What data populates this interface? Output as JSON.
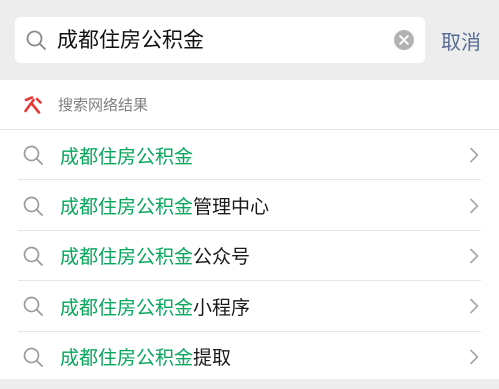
{
  "search": {
    "query": "成都住房公积金",
    "cancel_label": "取消"
  },
  "section": {
    "title": "搜索网络结果",
    "logo_icon": "souyisou-logo-icon",
    "logo_color": "#e53935"
  },
  "results": [
    {
      "highlight": "成都住房公积金",
      "suffix": ""
    },
    {
      "highlight": "成都住房公积金",
      "suffix": "管理中心"
    },
    {
      "highlight": "成都住房公积金",
      "suffix": "公众号"
    },
    {
      "highlight": "成都住房公积金",
      "suffix": "小程序"
    },
    {
      "highlight": "成都住房公积金",
      "suffix": "提取"
    }
  ],
  "colors": {
    "highlight": "#07a75c",
    "link": "#576b95",
    "bar_background": "#ededed"
  }
}
